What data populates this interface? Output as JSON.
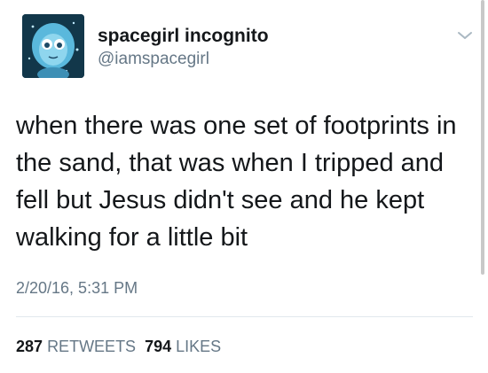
{
  "tweet": {
    "display_name": "spacegirl incognito",
    "handle": "@iamspacegirl",
    "text": "when there was one set of footprints in the sand, that was when I tripped and fell but Jesus didn't see and he kept walking for a little bit",
    "timestamp": "2/20/16, 5:31 PM",
    "retweets": {
      "count": "287",
      "label": "RETWEETS"
    },
    "likes": {
      "count": "794",
      "label": "LIKES"
    }
  },
  "icons": {
    "menu": "chevron-down-icon",
    "avatar": "avatar"
  },
  "colors": {
    "text": "#14171a",
    "secondary": "#657786",
    "divider": "#e1e8ed",
    "avatar_bg": "#12374a"
  }
}
